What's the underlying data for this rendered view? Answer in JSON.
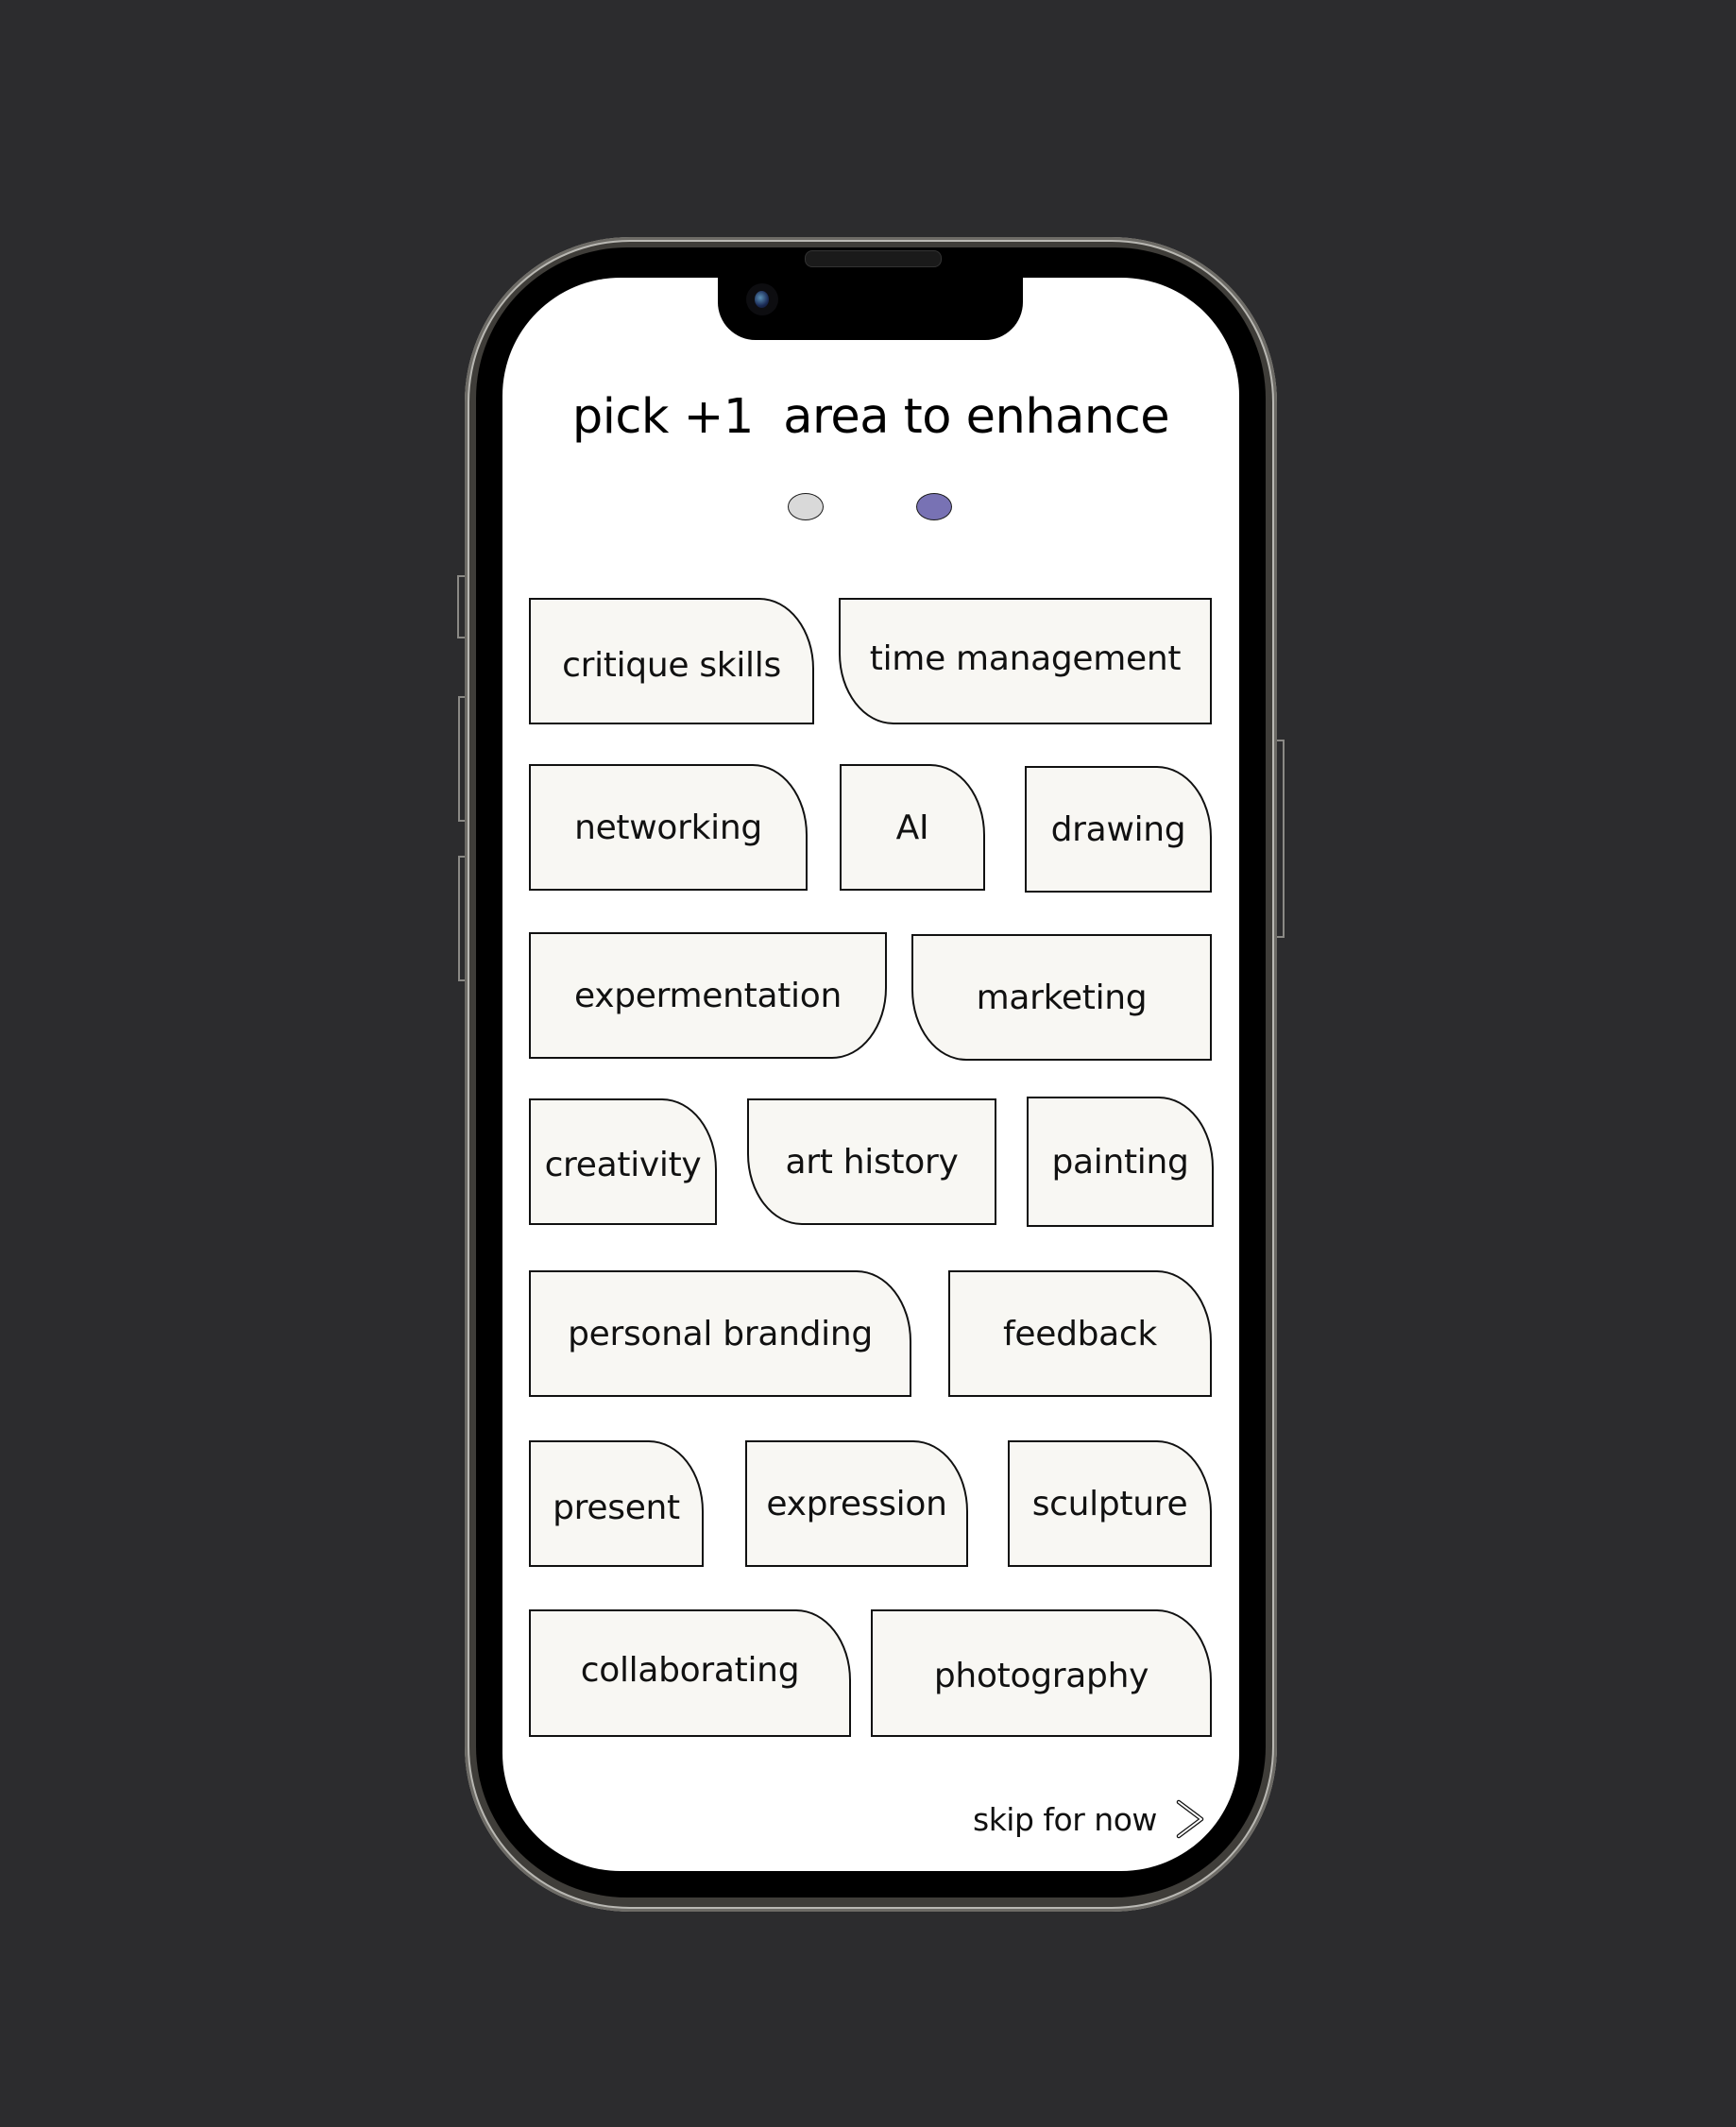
{
  "screen": {
    "title": "pick +1  area to enhance",
    "pagination": {
      "total": 2,
      "current": 2,
      "dots": [
        {
          "state": "inactive",
          "color": "#d9d9d9"
        },
        {
          "state": "active",
          "color": "#7872b4"
        }
      ]
    },
    "chips": [
      {
        "label": "critique skills",
        "selected": false
      },
      {
        "label": "time management",
        "selected": false
      },
      {
        "label": "networking",
        "selected": false
      },
      {
        "label": "AI",
        "selected": false
      },
      {
        "label": "drawing",
        "selected": false
      },
      {
        "label": "expermentation",
        "selected": false
      },
      {
        "label": "marketing",
        "selected": false
      },
      {
        "label": "creativity",
        "selected": false
      },
      {
        "label": "art history",
        "selected": false
      },
      {
        "label": "painting",
        "selected": false
      },
      {
        "label": "personal branding",
        "selected": false
      },
      {
        "label": "feedback",
        "selected": false
      },
      {
        "label": "present",
        "selected": false
      },
      {
        "label": "expression",
        "selected": false
      },
      {
        "label": "sculpture",
        "selected": false
      },
      {
        "label": "collaborating",
        "selected": false
      },
      {
        "label": "photography",
        "selected": false
      }
    ],
    "skip": {
      "label": "skip for now",
      "icon": "chevron-right-icon"
    }
  },
  "colors": {
    "background": "#2c2c2e",
    "chip_fill": "#f8f7f3",
    "chip_border": "#111111",
    "accent": "#7872b4"
  }
}
